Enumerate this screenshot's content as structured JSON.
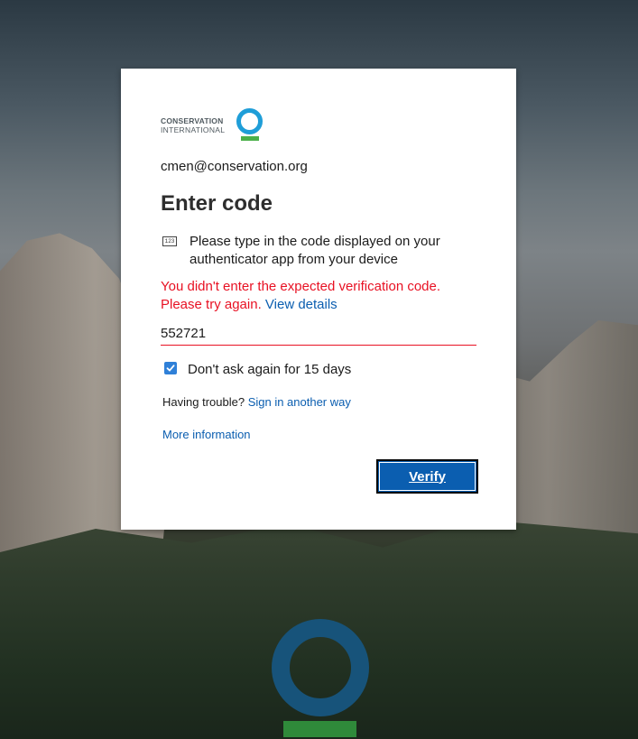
{
  "org": {
    "logo_line1": "CONSERVATION",
    "logo_line2": "INTERNATIONAL"
  },
  "account": {
    "email": "cmen@conservation.org"
  },
  "heading": "Enter code",
  "instruction": {
    "icon_label": "123",
    "text": "Please type in the code displayed on your authenticator app from your device"
  },
  "error": {
    "message": "You didn't enter the expected verification code. Please try again.",
    "details_link": "View details"
  },
  "code_field": {
    "value": "552721"
  },
  "remember": {
    "checked": true,
    "label": "Don't ask again for 15 days"
  },
  "trouble": {
    "prefix": "Having trouble?",
    "link": "Sign in another way"
  },
  "more_info": "More information",
  "verify_label": "Verify",
  "colors": {
    "accent": "#0b5eb0",
    "error": "#e81123",
    "logo_blue": "#1f9ed8",
    "logo_green": "#4bb04a"
  }
}
